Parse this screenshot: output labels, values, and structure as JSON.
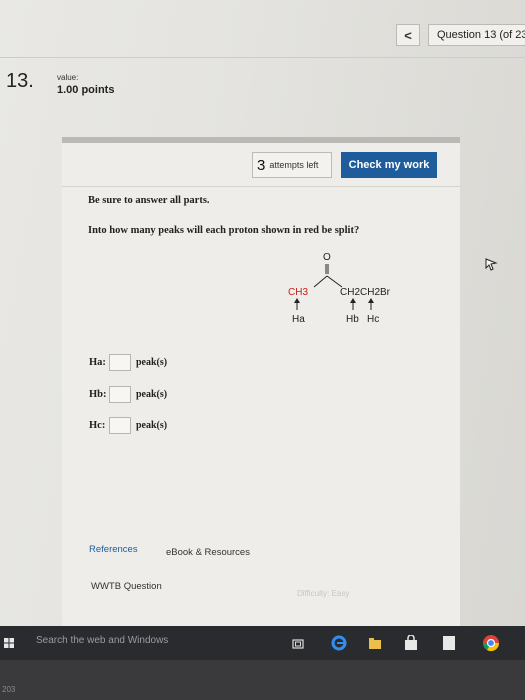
{
  "header": {
    "prev_glyph": "<",
    "question_counter": "Question 13 (of 23)",
    "question_number": "13.",
    "value_label": "value:",
    "points": "1.00 points"
  },
  "toolbar": {
    "attempts_count": "3",
    "attempts_text": "attempts left",
    "check_label": "Check my work"
  },
  "question": {
    "instruction": "Be sure to answer all parts.",
    "prompt": "Into how many peaks will each proton shown in red be split?"
  },
  "molecule": {
    "carbonyl_o": "O",
    "left_group": "CH3",
    "right_group": "CH2CH2Br",
    "ha": "Ha",
    "hb": "Hb",
    "hc": "Hc"
  },
  "answers": [
    {
      "label": "Ha:",
      "unit": "peak(s)",
      "value": ""
    },
    {
      "label": "Hb:",
      "unit": "peak(s)",
      "value": ""
    },
    {
      "label": "Hc:",
      "unit": "peak(s)",
      "value": ""
    }
  ],
  "footer": {
    "references": "References",
    "ebook": "eBook & Resources",
    "wwtb": "WWTB Question",
    "difficulty": "Difficulty: Easy"
  },
  "taskbar": {
    "search_text": "Search the web and Windows",
    "strip_number": "203"
  },
  "colors": {
    "check_button": "#1f5c9c",
    "proton_red": "#c0231f"
  }
}
